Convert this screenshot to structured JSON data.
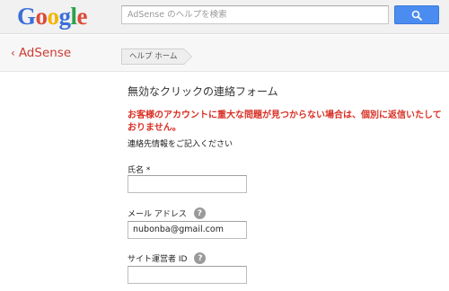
{
  "header": {
    "logo_letters": [
      {
        "ch": "G",
        "color": "#3b6fd8"
      },
      {
        "ch": "o",
        "color": "#dd4b39"
      },
      {
        "ch": "o",
        "color": "#f4b400"
      },
      {
        "ch": "g",
        "color": "#3b6fd8"
      },
      {
        "ch": "l",
        "color": "#2aa24a"
      },
      {
        "ch": "e",
        "color": "#dd4b39"
      }
    ],
    "search_placeholder": "AdSense のヘルプを検索",
    "search_button_icon": "search-icon"
  },
  "subheader": {
    "back_link": "AdSense",
    "back_chevron": "‹",
    "breadcrumb": "ヘルプ ホーム"
  },
  "form": {
    "title": "無効なクリックの連絡フォーム",
    "warning": "お客様のアカウントに重大な問題が見つからない場合は、個別に返信いたしておりません。",
    "intro": "連絡先情報をご記入ください",
    "fields": {
      "name_label": "氏名 *",
      "name_value": "",
      "email_label": "メール アドレス",
      "email_value": "nubonba@gmail.com",
      "publisher_label": "サイト運営者 ID",
      "publisher_value": ""
    },
    "help_glyph": "?"
  },
  "colors": {
    "accent_red": "#cc3b33",
    "warning_red": "#d93025",
    "search_button": "#4a8cf0"
  }
}
